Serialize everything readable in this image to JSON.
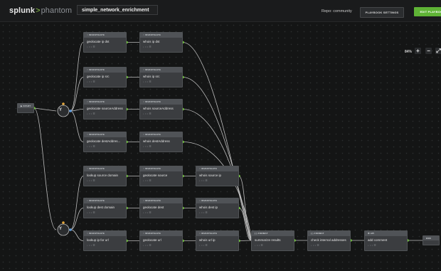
{
  "brand": {
    "name": "splunk",
    "separator": ">",
    "product": "phantom"
  },
  "playbook_name": "simple_network_enrichment",
  "repo_label": "Repo: community",
  "buttons": {
    "settings": "PLAYBOOK SETTINGS",
    "edit": "EDIT PLAYBOOK"
  },
  "zoom": {
    "level": "84%",
    "zoom_in": "+",
    "zoom_out": "−",
    "fit": "⤢"
  },
  "colors": {
    "accent": "#5fb336",
    "wire": "#bdbdbd",
    "connector": "#6ec13b",
    "decision_top": "#e3a63b",
    "decision_side": "#5e9de0"
  },
  "start": {
    "header": "▶ START"
  },
  "end": {
    "header": "END"
  },
  "decisions": [
    {
      "symbol": "Y"
    },
    {
      "symbol": "Y"
    }
  ],
  "nodes": [
    {
      "header": "○ INVESTIGATE",
      "title": "geolocate ip dst",
      "icons": "↓ ○ ↕ ☰"
    },
    {
      "header": "○ INVESTIGATE",
      "title": "whois ip dst",
      "icons": "↓ ○ ↕ ☰"
    },
    {
      "header": "○ INVESTIGATE",
      "title": "geolocate ip src",
      "icons": "↓ ○ ↕ ☰"
    },
    {
      "header": "○ INVESTIGATE",
      "title": "whois ip src",
      "icons": "↓ ○ ↕ ☰"
    },
    {
      "header": "○ INVESTIGATE",
      "title": "geolocate sourceAddress",
      "icons": "↓ ○ ↕ ☰"
    },
    {
      "header": "○ INVESTIGATE",
      "title": "whois sourceAddress",
      "icons": "↓ ○ ↕ ☰"
    },
    {
      "header": "○ INVESTIGATE",
      "title": "geolocate destAddres...",
      "icons": "↓ ○ ↕ ☰"
    },
    {
      "header": "○ INVESTIGATE",
      "title": "whois destAddress",
      "icons": "↓ ○ ↕ ☰"
    },
    {
      "header": "○ INVESTIGATE",
      "title": "lookup source domain",
      "icons": "↓ ○ ↕ ☰"
    },
    {
      "header": "○ INVESTIGATE",
      "title": "geolocate source",
      "icons": "↓ ○ ↕ ☰"
    },
    {
      "header": "○ INVESTIGATE",
      "title": "whois source ip",
      "icons": "↓ ○ ↕ ☰"
    },
    {
      "header": "○ INVESTIGATE",
      "title": "lookup dest domain",
      "icons": "↓ ○ ↕ ☰"
    },
    {
      "header": "○ INVESTIGATE",
      "title": "geolocate dest",
      "icons": "↓ ○ ↕ ☰"
    },
    {
      "header": "○ INVESTIGATE",
      "title": "whois dest ip",
      "icons": "↓ ○ ↕ ☰"
    },
    {
      "header": "○ INVESTIGATE",
      "title": "lookup ip for url",
      "icons": "↓ ○ ↕ ☰"
    },
    {
      "header": "○ INVESTIGATE",
      "title": "geolocate url",
      "icons": "↓ ○ ↕ ☰"
    },
    {
      "header": "○ INVESTIGATE",
      "title": "whois url ip",
      "icons": "↓ ○ ↕ ☰"
    },
    {
      "header": "{ } FORMAT",
      "title": "summarize results",
      "icons": "↓ ○ ↕ ☰"
    },
    {
      "header": "{ } FORMAT",
      "title": "check internal addresses",
      "icons": "↓ ○ ↕ ☰"
    },
    {
      "header": "⚙ API",
      "title": "add comment",
      "icons": "↓ ○ ↕ ☰"
    }
  ]
}
